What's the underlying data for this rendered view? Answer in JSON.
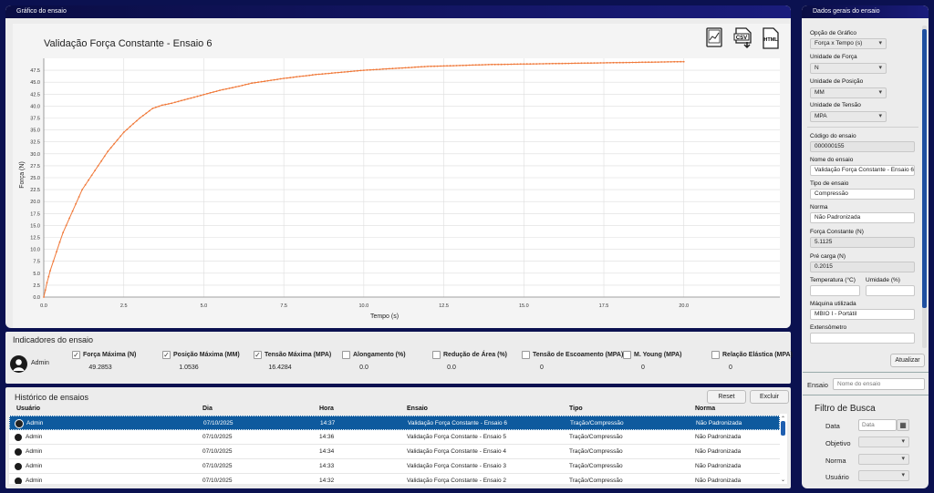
{
  "chart_panel": {
    "header": "Gráfico do ensaio",
    "export": {
      "png": "chart-export-icon",
      "csv": "CSV",
      "html": "HTML"
    }
  },
  "chart_data": {
    "type": "line",
    "title": "Validação Força Constante - Ensaio 6",
    "xlabel": "Tempo (s)",
    "ylabel": "Força (N)",
    "xlim": [
      0,
      23.0
    ],
    "ylim": [
      0,
      50
    ],
    "xticks": [
      "0.0",
      "2.5",
      "5.0",
      "7.5",
      "10.0",
      "12.5",
      "15.0",
      "17.5",
      "20.0"
    ],
    "yticks": [
      "0.0",
      "2.5",
      "5.0",
      "7.5",
      "10.0",
      "12.5",
      "15.0",
      "17.5",
      "20.0",
      "22.5",
      "25.0",
      "27.5",
      "30.0",
      "32.5",
      "35.0",
      "37.5",
      "40.0",
      "42.5",
      "45.0",
      "47.5"
    ],
    "grid": true,
    "color": "#f07838",
    "x": [
      0,
      0.1,
      0.2,
      0.4,
      0.6,
      0.9,
      1.2,
      1.6,
      2.0,
      2.5,
      3.0,
      3.4,
      3.7,
      4.0,
      4.5,
      5.0,
      5.5,
      6.0,
      6.5,
      7.0,
      7.5,
      8.0,
      8.5,
      9.0,
      9.5,
      10.0,
      11.0,
      12.0,
      13.0,
      14.0,
      15.0,
      16.0,
      17.0,
      18.0,
      19.0,
      20.0
    ],
    "y": [
      0,
      3.0,
      5.5,
      9.5,
      13.5,
      18.0,
      22.5,
      26.5,
      30.5,
      34.5,
      37.5,
      39.5,
      40.2,
      40.6,
      41.5,
      42.4,
      43.3,
      44.0,
      44.8,
      45.3,
      45.8,
      46.2,
      46.6,
      46.9,
      47.2,
      47.5,
      47.9,
      48.3,
      48.5,
      48.7,
      48.8,
      48.9,
      49.0,
      49.1,
      49.2,
      49.3
    ]
  },
  "right_panel": {
    "header": "Dados gerais do ensaio",
    "opcao_grafico": {
      "label": "Opção de Gráfico",
      "value": "Força x Tempo (s)"
    },
    "unidade_forca": {
      "label": "Unidade de Força",
      "value": "N"
    },
    "unidade_posicao": {
      "label": "Unidade de Posição",
      "value": "MM"
    },
    "unidade_tensao": {
      "label": "Unidade de Tensão",
      "value": "MPA"
    },
    "codigo": {
      "label": "Código do ensaio",
      "value": "000000155"
    },
    "nome": {
      "label": "Nome do ensaio",
      "value": "Validação Força Constante - Ensaio 6"
    },
    "tipo": {
      "label": "Tipo de ensaio",
      "value": "Compressão"
    },
    "norma": {
      "label": "Norma",
      "value": "Não Padronizada"
    },
    "forca_constante": {
      "label": "Força Constante (N)",
      "value": "5.1125"
    },
    "pre_carga": {
      "label": "Pré carga (N)",
      "value": "0.2015"
    },
    "temperatura": {
      "label": "Temperatura (°C)",
      "value": ""
    },
    "umidade": {
      "label": "Umidade (%)",
      "value": ""
    },
    "maquina": {
      "label": "Máquina utilizada",
      "value": "MBIO I - Portátil"
    },
    "extensometro": {
      "label": "Extensômetro",
      "value": ""
    },
    "atualizar": "Atualizar",
    "ensaio_label": "Ensaio",
    "ensaio_placeholder": "Nome do ensaio",
    "filtro": {
      "title": "Filtro de Busca",
      "data_label": "Data",
      "data_placeholder": "Data",
      "objetivo_label": "Objetivo",
      "norma_label": "Norma",
      "usuario_label": "Usuário"
    }
  },
  "indicators": {
    "title": "Indicadores do ensaio",
    "user": "Admin",
    "items": [
      {
        "label": "Força Máxima (N)",
        "checked": true,
        "value": "49.2853"
      },
      {
        "label": "Posição Máxima (MM)",
        "checked": true,
        "value": "1.0536"
      },
      {
        "label": "Tensão Máxima (MPA)",
        "checked": true,
        "value": "16.4284"
      },
      {
        "label": "Alongamento (%)",
        "checked": false,
        "value": "0.0"
      },
      {
        "label": "Redução de Área (%)",
        "checked": false,
        "value": "0.0"
      },
      {
        "label": "Tensão de Escoamento (MPA)",
        "checked": false,
        "value": "0"
      },
      {
        "label": "M. Young (MPA)",
        "checked": false,
        "value": "0"
      },
      {
        "label": "Relação Elástica (MPA)",
        "checked": false,
        "value": "0"
      }
    ]
  },
  "history": {
    "title": "Histórico de ensaios",
    "reset": "Reset",
    "excluir": "Excluir",
    "columns": [
      "Usuário",
      "Dia",
      "Hora",
      "Ensaio",
      "Tipo",
      "Norma"
    ],
    "rows": [
      [
        "Admin",
        "07/10/2025",
        "14:37",
        "Validação Força Constante - Ensaio 6",
        "Tração/Compressão",
        "Não Padronizada"
      ],
      [
        "Admin",
        "07/10/2025",
        "14:36",
        "Validação Força Constante - Ensaio 5",
        "Tração/Compressão",
        "Não Padronizada"
      ],
      [
        "Admin",
        "07/10/2025",
        "14:34",
        "Validação Força Constante - Ensaio 4",
        "Tração/Compressão",
        "Não Padronizada"
      ],
      [
        "Admin",
        "07/10/2025",
        "14:33",
        "Validação Força Constante - Ensaio 3",
        "Tração/Compressão",
        "Não Padronizada"
      ],
      [
        "Admin",
        "07/10/2025",
        "14:32",
        "Validação Força Constante - Ensaio 2",
        "Tração/Compressão",
        "Não Padronizada"
      ]
    ]
  }
}
